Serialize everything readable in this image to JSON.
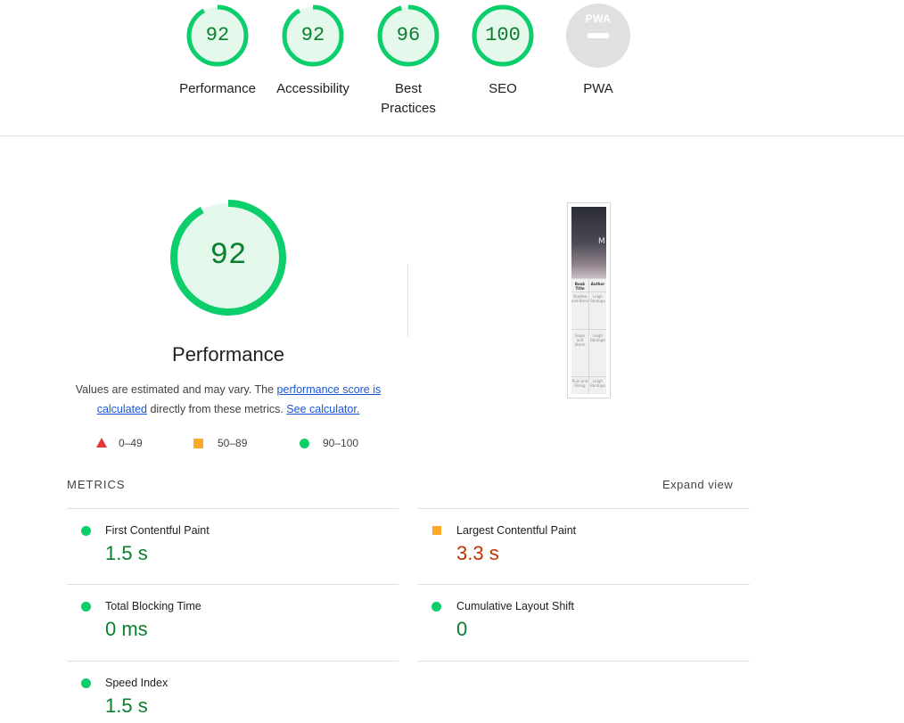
{
  "colors": {
    "pass": "#0cce6b",
    "pass_text": "#0a7f2e",
    "average": "#ffa726",
    "average_text": "#c33300",
    "fail": "#e53935",
    "link": "#1a57d6",
    "pwa_gray": "#e0e0e0"
  },
  "categories": [
    {
      "score": "92",
      "label": "Performance",
      "fraction": 0.92
    },
    {
      "score": "92",
      "label": "Accessibility",
      "fraction": 0.92
    },
    {
      "score": "96",
      "label": "Best Practices",
      "fraction": 0.96
    },
    {
      "score": "100",
      "label": "SEO",
      "fraction": 1.0
    },
    {
      "score": "",
      "label": "PWA",
      "badge": "PWA",
      "icon": "pwa-badge-icon"
    }
  ],
  "performance": {
    "score": "92",
    "fraction": 0.92,
    "title": "Performance",
    "desc_prefix": "Values are estimated and may vary. The ",
    "desc_link1": "performance score is calculated",
    "desc_middle": " directly from these metrics. ",
    "desc_link2": "See calculator."
  },
  "legend": [
    {
      "range": "0–49",
      "icon": "fail-triangle-icon"
    },
    {
      "range": "50–89",
      "icon": "average-square-icon"
    },
    {
      "range": "90–100",
      "icon": "pass-circle-icon"
    }
  ],
  "thumbnail": {
    "hero_mark": "M",
    "col1_header": "Book Title",
    "col2_header": "Author",
    "rows": [
      {
        "title": "Shadow and Bone",
        "author": "Leigh Bardugo"
      },
      {
        "title": "Siege and Storm",
        "author": "Leigh Bardugo"
      },
      {
        "title": "Ruin and Rising",
        "author": "Leigh Bardugo"
      }
    ]
  },
  "metrics": {
    "title": "METRICS",
    "expand_label": "Expand view",
    "items": [
      {
        "name": "First Contentful Paint",
        "value": "1.5 s",
        "rating": "pass"
      },
      {
        "name": "Largest Contentful Paint",
        "value": "3.3 s",
        "rating": "average"
      },
      {
        "name": "Total Blocking Time",
        "value": "0 ms",
        "rating": "pass"
      },
      {
        "name": "Cumulative Layout Shift",
        "value": "0",
        "rating": "pass"
      },
      {
        "name": "Speed Index",
        "value": "1.5 s",
        "rating": "pass"
      }
    ]
  }
}
